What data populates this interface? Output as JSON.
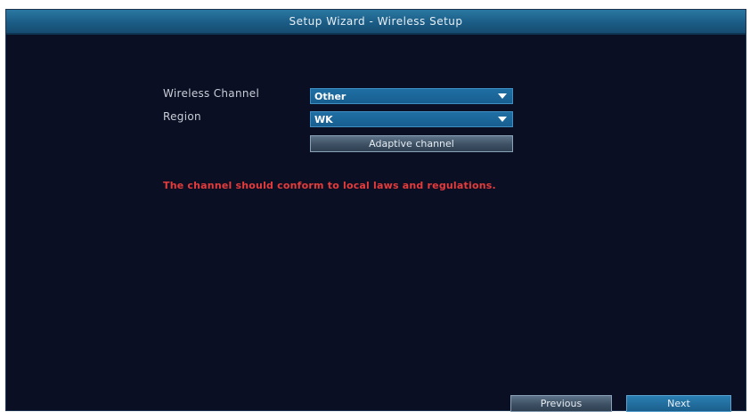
{
  "window": {
    "title": "Setup Wizard - Wireless Setup"
  },
  "form": {
    "channel_label": "Wireless Channel",
    "channel_value": "Other",
    "region_label": "Region",
    "region_value": "WK",
    "adaptive_button": "Adaptive channel",
    "warning": "The channel should conform to local laws and regulations."
  },
  "footer": {
    "previous_label": "Previous",
    "next_label": "Next"
  },
  "colors": {
    "background": "#0b0f24",
    "title_bar": "#1b5d86",
    "select": "#1f6fa4",
    "warning": "#e43b3b"
  }
}
